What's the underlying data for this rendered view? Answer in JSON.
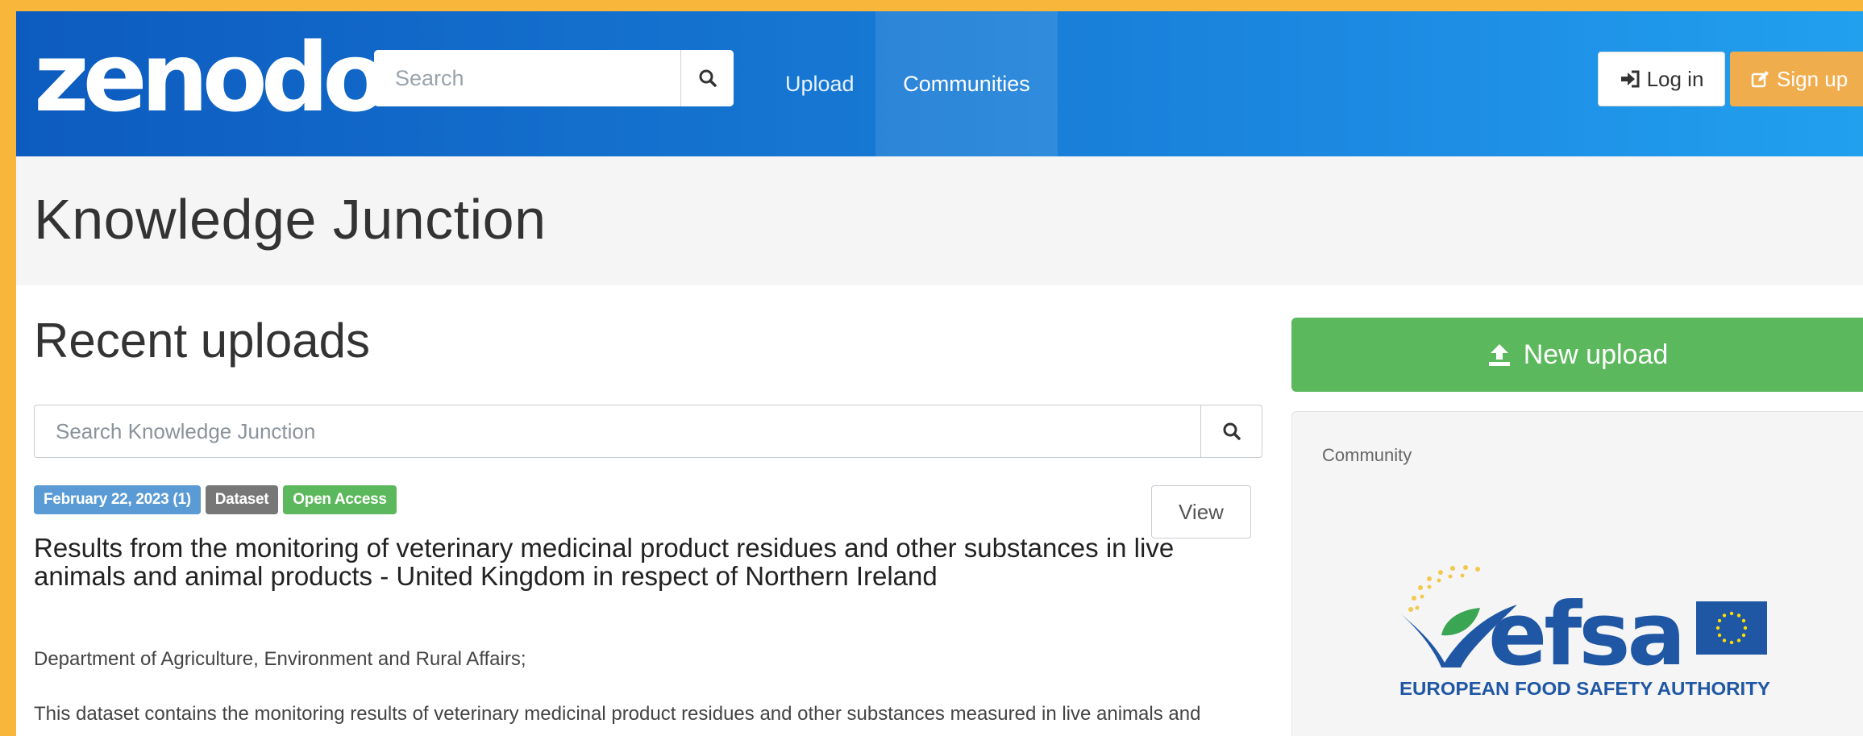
{
  "navbar": {
    "logo": "zenodo",
    "search_placeholder": "Search",
    "links": {
      "upload": "Upload",
      "communities": "Communities"
    },
    "login_label": "Log in",
    "signup_label": "Sign up"
  },
  "header": {
    "title": "Knowledge Junction"
  },
  "main": {
    "section_title": "Recent uploads",
    "search_placeholder": "Search Knowledge Junction",
    "record": {
      "badges": {
        "date": "February 22, 2023 (1)",
        "type": "Dataset",
        "access": "Open Access"
      },
      "view_label": "View",
      "title": "Results from the monitoring of veterinary medicinal product residues and other substances in live animals and animal products - United Kingdom in respect of Northern Ireland",
      "creators": "Department of Agriculture, Environment and Rural Affairs;",
      "description": "This dataset contains the monitoring results of veterinary medicinal product residues and other substances measured in live animals and animal products analysed by the national competent authority of United Kingdom in respect of Northern"
    }
  },
  "sidebar": {
    "new_upload_label": "New upload",
    "panel_label": "Community",
    "logo": {
      "wordmark": "efsa",
      "caption": "EUROPEAN FOOD SAFETY AUTHORITY"
    }
  },
  "colors": {
    "navbar_start": "#0d5bbf",
    "navbar_end": "#21a0ee",
    "signup": "#f0ad4e",
    "success": "#5cb85c",
    "badge_date": "#5a9bd5",
    "badge_type": "#777777",
    "efsa_blue": "#1f57a4",
    "efsa_green": "#3aa552",
    "frame_border": "#f8b73a"
  }
}
